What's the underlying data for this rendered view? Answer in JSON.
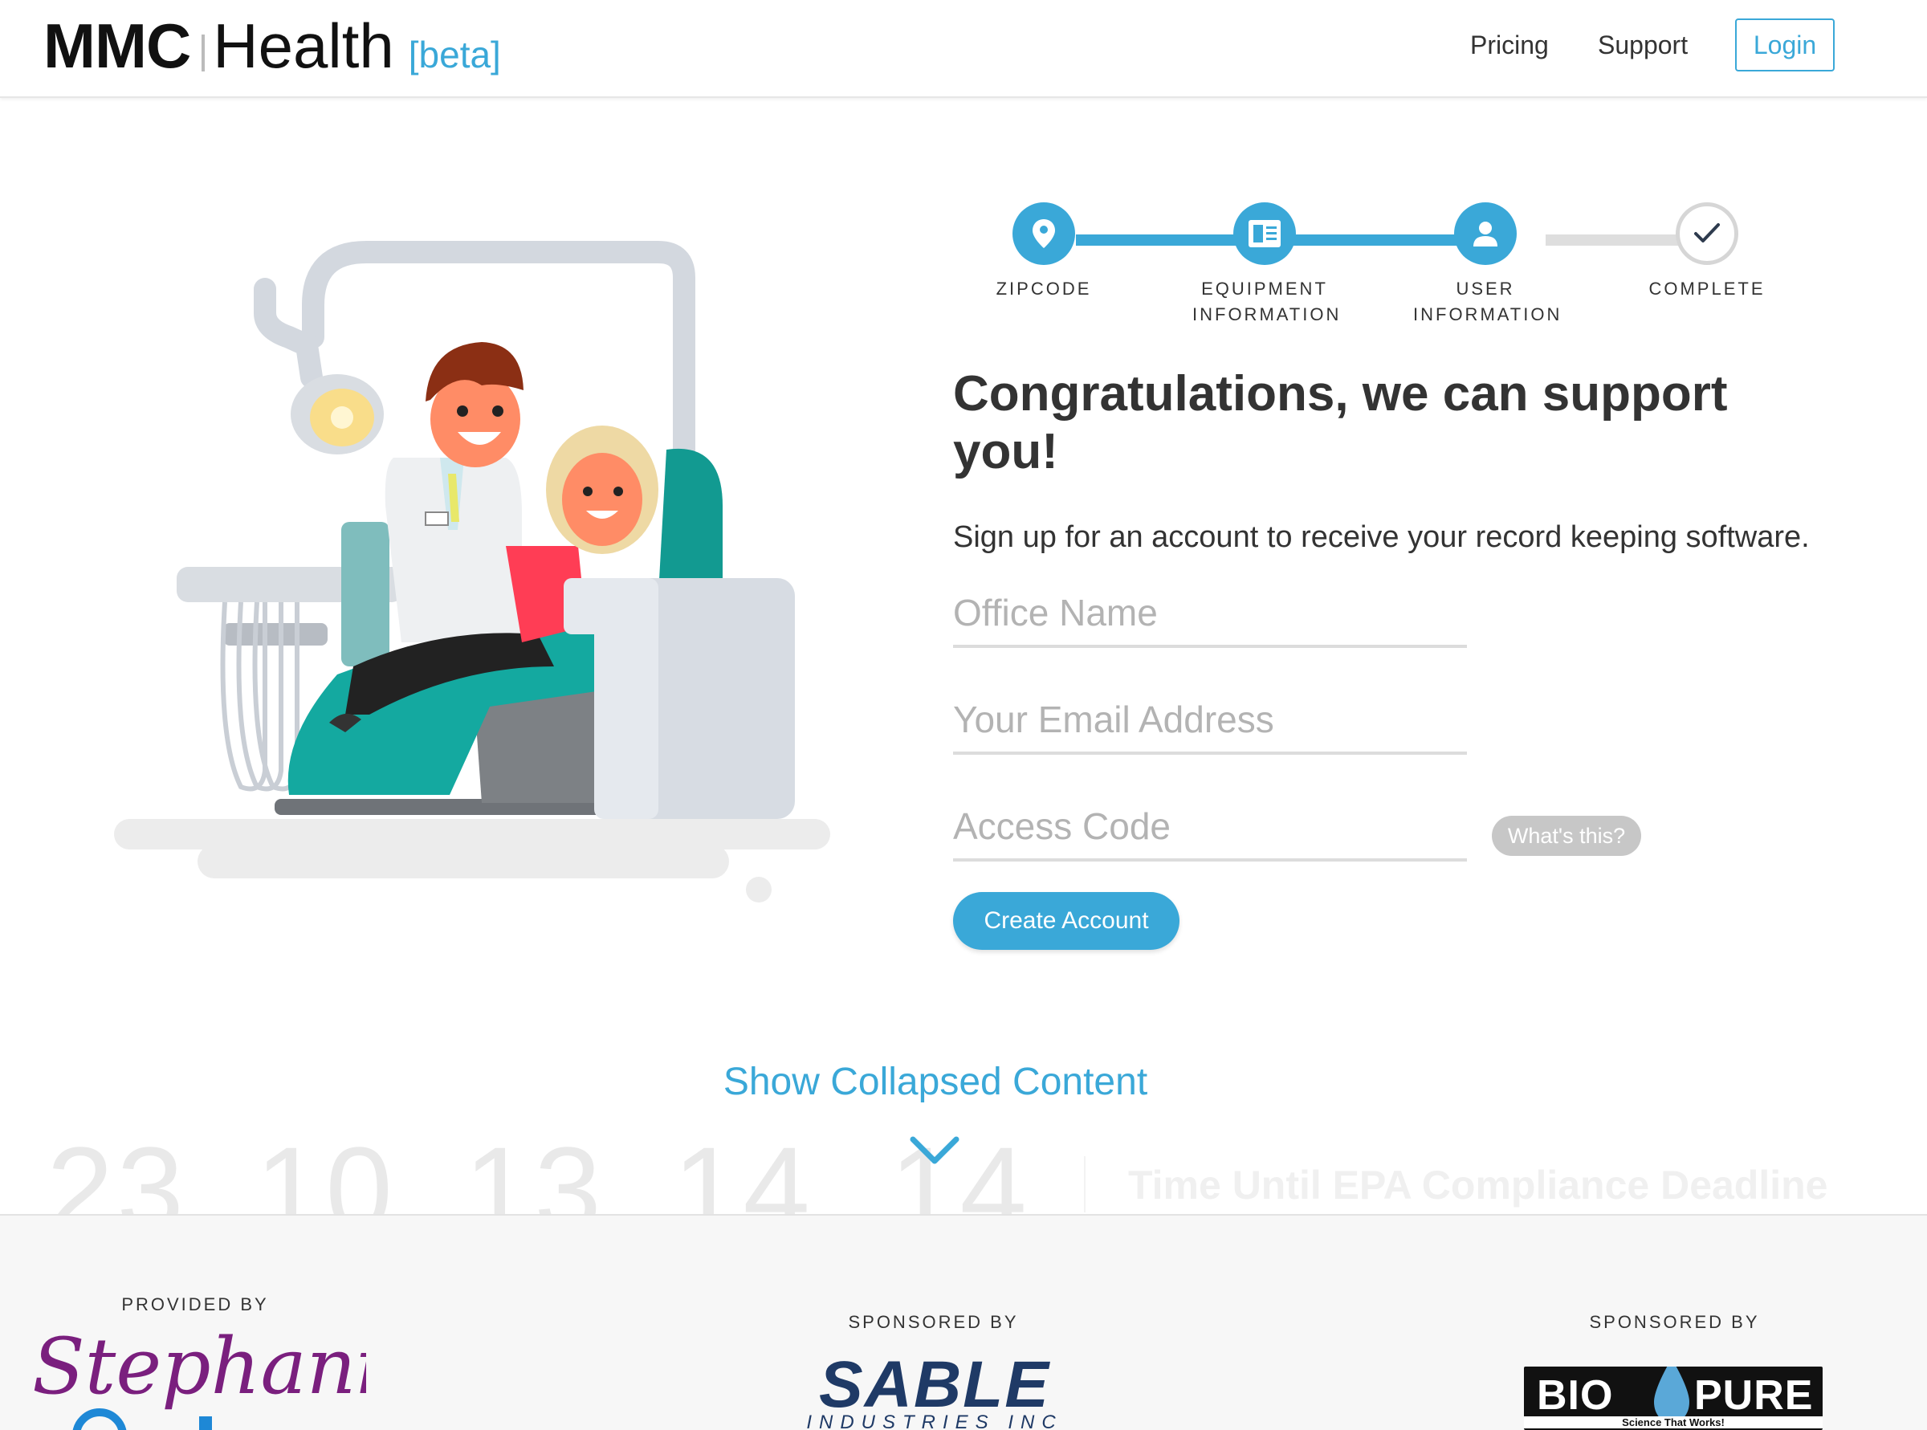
{
  "header": {
    "logo": {
      "brand": "MMC",
      "product": "Health",
      "tag": "[beta]"
    },
    "nav": {
      "pricing": "Pricing",
      "support": "Support",
      "login": "Login"
    }
  },
  "stepper": {
    "steps": [
      {
        "label": "ZIPCODE",
        "icon": "location-pin-icon",
        "state": "active"
      },
      {
        "label": "EQUIPMENT",
        "label2": "INFORMATION",
        "icon": "document-icon",
        "state": "active"
      },
      {
        "label": "USER",
        "label2": "INFORMATION",
        "icon": "user-icon",
        "state": "active"
      },
      {
        "label": "COMPLETE",
        "icon": "checkmark-icon",
        "state": "pending"
      }
    ]
  },
  "main": {
    "headline": "Congratulations, we can support you!",
    "subhead": "Sign up for an account to receive your record keeping software.",
    "fields": {
      "office_name": {
        "placeholder": "Office Name",
        "value": ""
      },
      "email": {
        "placeholder": "Your Email Address",
        "value": ""
      },
      "access_code": {
        "placeholder": "Access Code",
        "value": ""
      }
    },
    "whats_this": "What's this?",
    "create_account": "Create Account"
  },
  "collapsed": {
    "toggle_label": "Show Collapsed Content",
    "countdown": [
      "23",
      "10",
      "13",
      "14",
      "14"
    ],
    "countdown_label": "Time Until EPA Compliance Deadline"
  },
  "footer": {
    "provided_by": "PROVIDED BY",
    "sponsored_by_1": "SPONSORED BY",
    "sponsored_by_2": "SPONSORED BY",
    "provider_logo": "Stephanie",
    "sponsor1_logo": "SABLE",
    "sponsor1_sub": "INDUSTRIES INC",
    "sponsor2_logo_left": "BIO",
    "sponsor2_logo_right": "PURE",
    "sponsor2_tagline": "Science That Works!"
  },
  "colors": {
    "accent": "#3aa8d8",
    "teal_chair": "#14a9a0",
    "placeholder": "#b3b3b3",
    "pill_gray": "#c7c7c7"
  }
}
